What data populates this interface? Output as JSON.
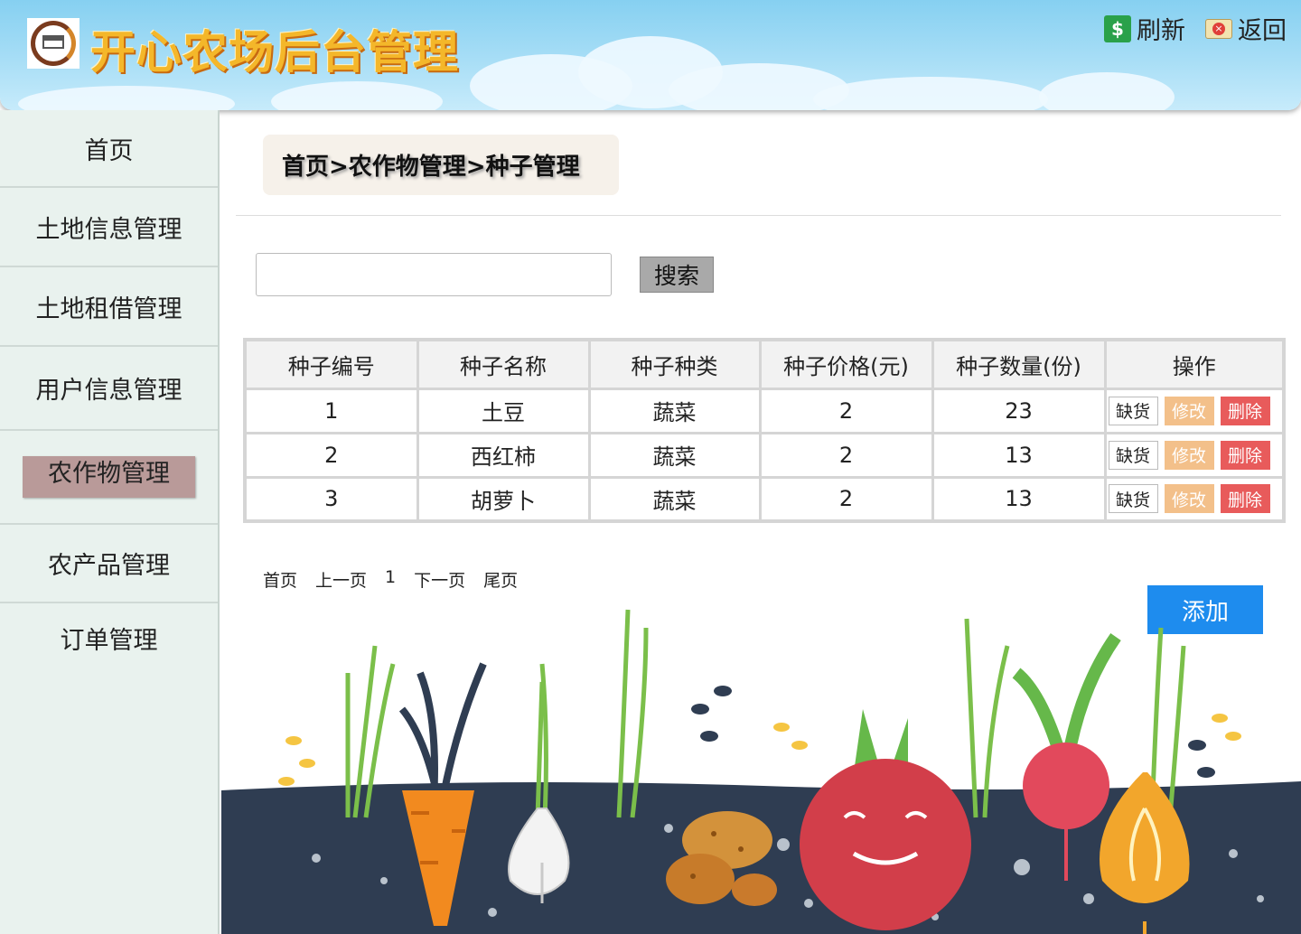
{
  "header": {
    "title": "开心农场后台管理",
    "refresh_label": "刷新",
    "back_label": "返回"
  },
  "sidebar": {
    "items": [
      {
        "label": "首页"
      },
      {
        "label": "土地信息管理"
      },
      {
        "label": "土地租借管理"
      },
      {
        "label": "用户信息管理"
      },
      {
        "label": "农作物管理"
      },
      {
        "label": "农产品管理"
      },
      {
        "label": "订单管理"
      }
    ],
    "active_index": 4
  },
  "breadcrumb": "首页>农作物管理>种子管理",
  "search": {
    "value": "",
    "placeholder": "",
    "button_label": "搜索"
  },
  "table": {
    "headers": [
      "种子编号",
      "种子名称",
      "种子种类",
      "种子价格(元)",
      "种子数量(份)",
      "操作"
    ],
    "rows": [
      {
        "id": "1",
        "name": "土豆",
        "type": "蔬菜",
        "price": "2",
        "qty": "23"
      },
      {
        "id": "2",
        "name": "西红柿",
        "type": "蔬菜",
        "price": "2",
        "qty": "13"
      },
      {
        "id": "3",
        "name": "胡萝卜",
        "type": "蔬菜",
        "price": "2",
        "qty": "13"
      }
    ],
    "actions": {
      "stock": "缺货",
      "edit": "修改",
      "delete": "删除"
    }
  },
  "pager": {
    "first": "首页",
    "prev": "上一页",
    "current": "1",
    "next": "下一页",
    "last": "尾页"
  },
  "add_button": "添加",
  "colors": {
    "header_sky": "#a8def6",
    "sidebar_bg": "#e9f2ee",
    "active_nav": "#b99a99",
    "add_button": "#1e8cee",
    "edit_button": "#f3c08a",
    "delete_button": "#e85b5b",
    "soil": "#2f3d52"
  }
}
